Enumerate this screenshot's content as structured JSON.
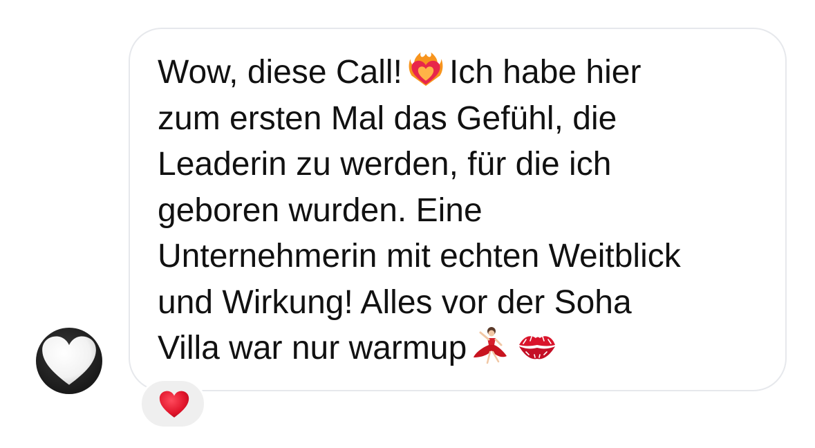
{
  "avatar": {
    "icon": "white-heart-icon"
  },
  "message": {
    "lines": [
      {
        "text": "Wow, diese Call!",
        "emoji": "heart-on-fire-icon",
        "after": "Ich habe hier"
      },
      {
        "text": "zum ersten Mal das Gefühl, die"
      },
      {
        "text": "Leaderin zu werden, für die ich"
      },
      {
        "text": "geboren wurden. Eine"
      },
      {
        "text": "Unternehmerin mit echten Weitblick"
      },
      {
        "text": "und Wirkung! Alles vor der Soha"
      },
      {
        "text": "Villa war nur warmup",
        "emojis": [
          "dancer-icon",
          "kiss-mark-icon"
        ]
      }
    ]
  },
  "reaction": {
    "icon": "red-heart-icon"
  },
  "colors": {
    "bubble_border": "#e6e8ec",
    "text": "#111111",
    "reaction_bg": "#efefef",
    "heart_red": "#e0142a"
  }
}
